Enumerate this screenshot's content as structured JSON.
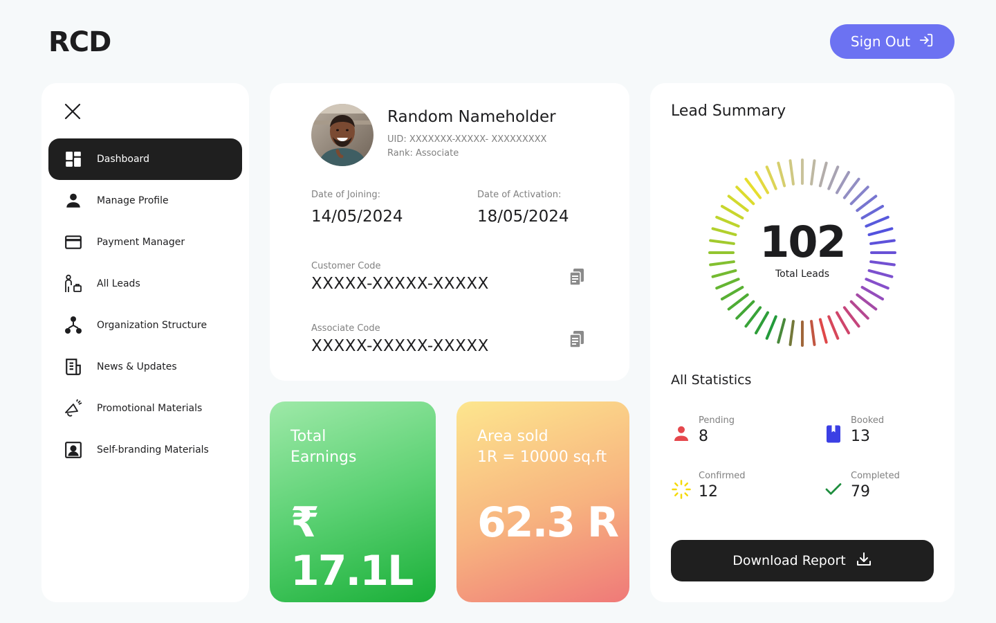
{
  "app": {
    "logo": "RCD",
    "sign_out_label": "Sign Out"
  },
  "sidebar": {
    "items": [
      {
        "label": "Dashboard",
        "icon": "dashboard-icon",
        "active": true
      },
      {
        "label": "Manage Profile",
        "icon": "person-icon"
      },
      {
        "label": "Payment Manager",
        "icon": "credit-card-icon"
      },
      {
        "label": "All Leads",
        "icon": "leads-icon"
      },
      {
        "label": "Organization Structure",
        "icon": "org-chart-icon"
      },
      {
        "label": "News & Updates",
        "icon": "news-icon"
      },
      {
        "label": "Promotional Materials",
        "icon": "megaphone-icon"
      },
      {
        "label": "Self-branding Materials",
        "icon": "portrait-icon"
      }
    ]
  },
  "profile": {
    "name": "Random Nameholder",
    "uid": "UID: XXXXXXX-XXXXX- XXXXXXXXX",
    "rank": "Rank: Associate",
    "joining_label": "Date of Joining:",
    "joining_date": "14/05/2024",
    "activation_label": "Date of Activation:",
    "activation_date": "18/05/2024",
    "customer_code_label": "Customer Code",
    "customer_code": "XXXXX-XXXXX-XXXXX",
    "associate_code_label": "Associate Code",
    "associate_code": "XXXXX-XXXXX-XXXXX"
  },
  "earnings": {
    "title": "Total\nEarnings",
    "value": "₹ 17.1L"
  },
  "area_sold": {
    "title": "Area sold\n1R = 10000 sq.ft",
    "value": "62.3 R"
  },
  "lead_summary": {
    "title": "Lead Summary",
    "total": "102",
    "total_label": "Total Leads",
    "stats_title": "All Statistics",
    "stats": [
      {
        "label": "Pending",
        "value": "8",
        "icon": "person-icon",
        "color": "#e5484d"
      },
      {
        "label": "Booked",
        "value": "13",
        "icon": "bookmark-book-icon",
        "color": "#3b3fe4"
      },
      {
        "label": "Confirmed",
        "value": "12",
        "icon": "loading-sparkle-icon",
        "color": "#f5d90a"
      },
      {
        "label": "Completed",
        "value": "79",
        "icon": "check-icon",
        "color": "#1e8e3e"
      }
    ],
    "download_label": "Download Report"
  },
  "colors": {
    "accent": "#6c72f2",
    "dark": "#1f1f1f",
    "background": "#f6f9fa"
  }
}
